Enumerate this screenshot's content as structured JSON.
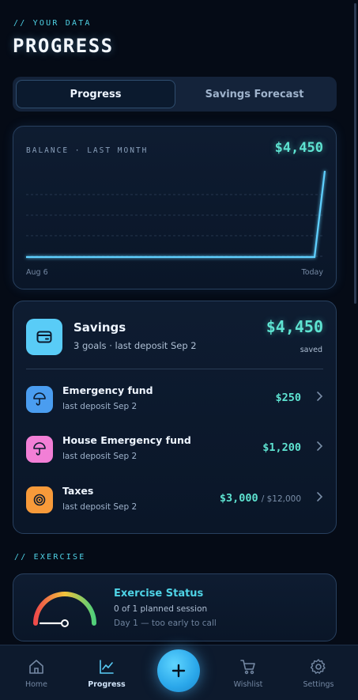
{
  "header": {
    "eyebrow": "// YOUR DATA",
    "title": "PROGRESS"
  },
  "segmented": {
    "tabs": [
      {
        "label": "Progress",
        "active": true
      },
      {
        "label": "Savings Forecast",
        "active": false
      }
    ]
  },
  "balance_card": {
    "label": "BALANCE · LAST MONTH",
    "value": "$4,450",
    "x_start": "Aug 6",
    "x_end": "Today"
  },
  "chart_data": {
    "type": "line",
    "x": [
      "Aug 6",
      "",
      "",
      "",
      "",
      "",
      "",
      "",
      "",
      "",
      "",
      "",
      "",
      "",
      "",
      "",
      "",
      "",
      "",
      "",
      "",
      "",
      "",
      "",
      "",
      "",
      "",
      "",
      "",
      "Today"
    ],
    "series": [
      {
        "values": [
          0,
          0,
          0,
          0,
          0,
          0,
          0,
          0,
          0,
          0,
          0,
          0,
          0,
          0,
          0,
          0,
          0,
          0,
          0,
          0,
          0,
          0,
          0,
          0,
          0,
          0,
          0,
          0,
          0,
          4450
        ]
      }
    ],
    "ylim": [
      0,
      4450
    ],
    "grid": true
  },
  "savings": {
    "title": "Savings",
    "subtitle": "3 goals · last deposit Sep 2",
    "amount": "$4,450",
    "amount_caption": "saved",
    "icon": "wallet-icon",
    "goals": [
      {
        "name": "Emergency fund",
        "sub": "last deposit Sep 2",
        "amount": "$250",
        "target": "",
        "icon": "umbrella-icon",
        "color": "#4a9df0"
      },
      {
        "name": "House Emergency fund",
        "sub": "last deposit Sep 2",
        "amount": "$1,200",
        "target": "",
        "icon": "umbrella-icon",
        "color": "#f27fd6"
      },
      {
        "name": "Taxes",
        "sub": "last deposit Sep 2",
        "amount": "$3,000",
        "target": "/ $12,000",
        "icon": "target-icon",
        "color": "#f79a3a"
      }
    ]
  },
  "exercise": {
    "section_label": "// EXERCISE",
    "title": "Exercise Status",
    "subtitle": "0 of 1 planned session",
    "note": "Day 1 — too early to call",
    "gauge_level": 0
  },
  "tabbar": {
    "items": [
      {
        "label": "Home",
        "icon": "home-icon",
        "active": false
      },
      {
        "label": "Progress",
        "icon": "chart-icon",
        "active": true
      },
      {
        "label": "Wishlist",
        "icon": "cart-icon",
        "active": false
      },
      {
        "label": "Settings",
        "icon": "gear-icon",
        "active": false
      }
    ],
    "fab_icon": "plus-icon"
  },
  "colors": {
    "accent": "#5ee3d1",
    "cyan": "#4fd3e6",
    "background": "#050b16"
  }
}
